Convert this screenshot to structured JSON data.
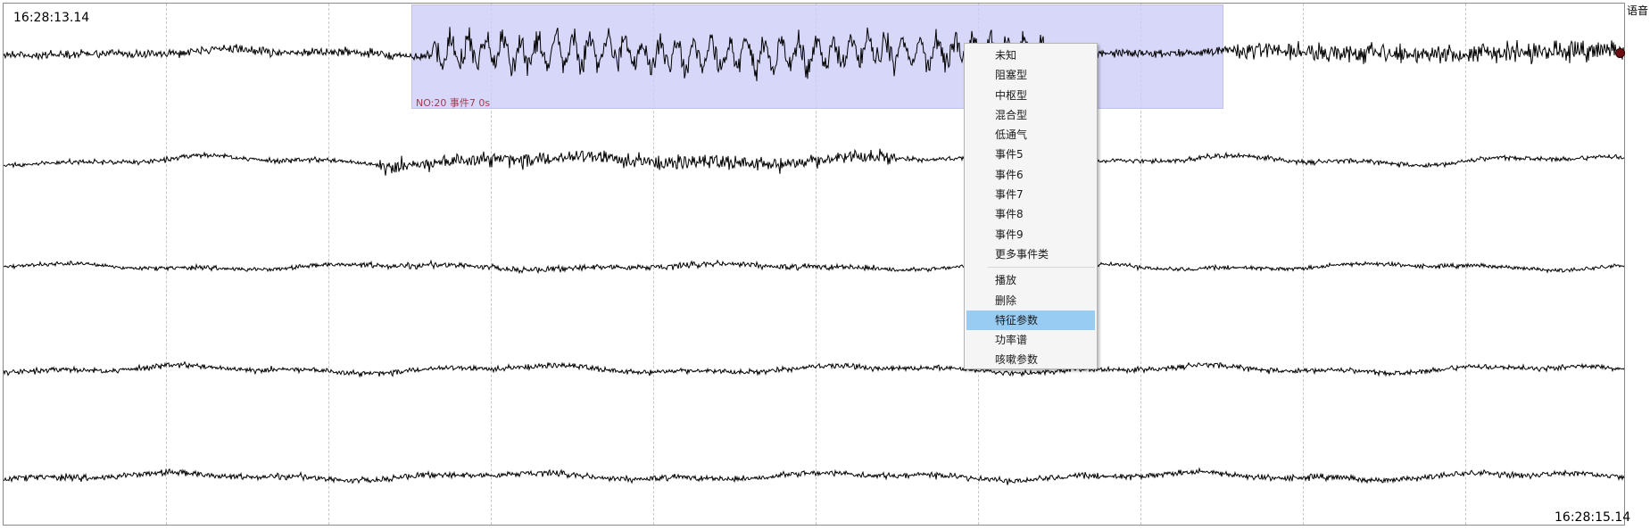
{
  "timestamps": {
    "start": "16:28:13.14",
    "end": "16:28:15.14"
  },
  "channel_label": "语音",
  "event": {
    "label": "NO:20 事件7 0s"
  },
  "context_menu": {
    "groups": [
      [
        "未知",
        "阻塞型",
        "中枢型",
        "混合型",
        "低通气",
        "事件5",
        "事件6",
        "事件7",
        "事件8",
        "事件9",
        "更多事件类"
      ],
      [
        "播放",
        "删除",
        "特征参数",
        "功率谱",
        "咳嗽参数"
      ]
    ],
    "highlighted": "特征参数"
  },
  "colors": {
    "waveform": "#000000",
    "selection_fill": "#cdcdf8",
    "menu_highlight": "#99ccf3",
    "event_label": "#a33a50",
    "marker": "#6a0f12"
  }
}
